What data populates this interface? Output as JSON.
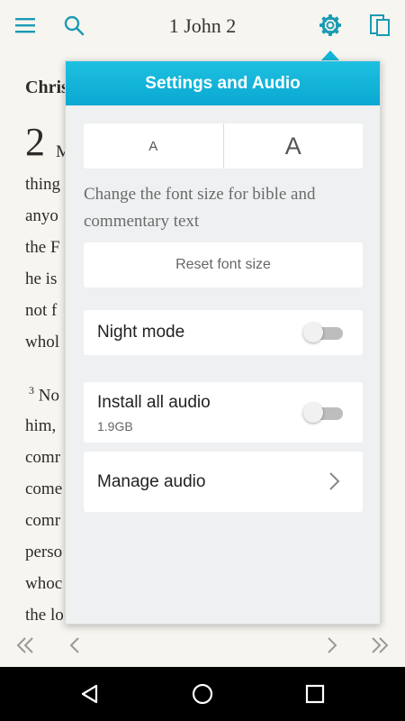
{
  "header": {
    "title": "1 John 2",
    "menu_icon": "hamburger-menu-icon",
    "search_icon": "search-icon",
    "settings_icon": "gear-icon",
    "layout_icon": "split-view-icon"
  },
  "reader": {
    "heading": "Chris",
    "chapter_number": "2",
    "lines": [
      "M",
      "thing",
      "anyo",
      "the F",
      "he is",
      "not f",
      "whol"
    ],
    "verse3_number": "3",
    "verse3_first": "No",
    "verse3_lines": [
      "him,",
      "comr",
      "come",
      "comr",
      "perso",
      "whoc",
      "the lo"
    ]
  },
  "settings": {
    "title": "Settings and Audio",
    "font_small_label": "A",
    "font_large_label": "A",
    "font_description": "Change the font size for bible and commentary text",
    "reset_label": "Reset font size",
    "night_mode_label": "Night mode",
    "night_mode_on": false,
    "install_audio_label": "Install all audio",
    "install_audio_size": "1.9GB",
    "install_audio_on": false,
    "manage_audio_label": "Manage audio"
  },
  "accent_color": "#1a9bb4",
  "header_gradient": [
    "#1ec0e0",
    "#0aa8d2"
  ]
}
